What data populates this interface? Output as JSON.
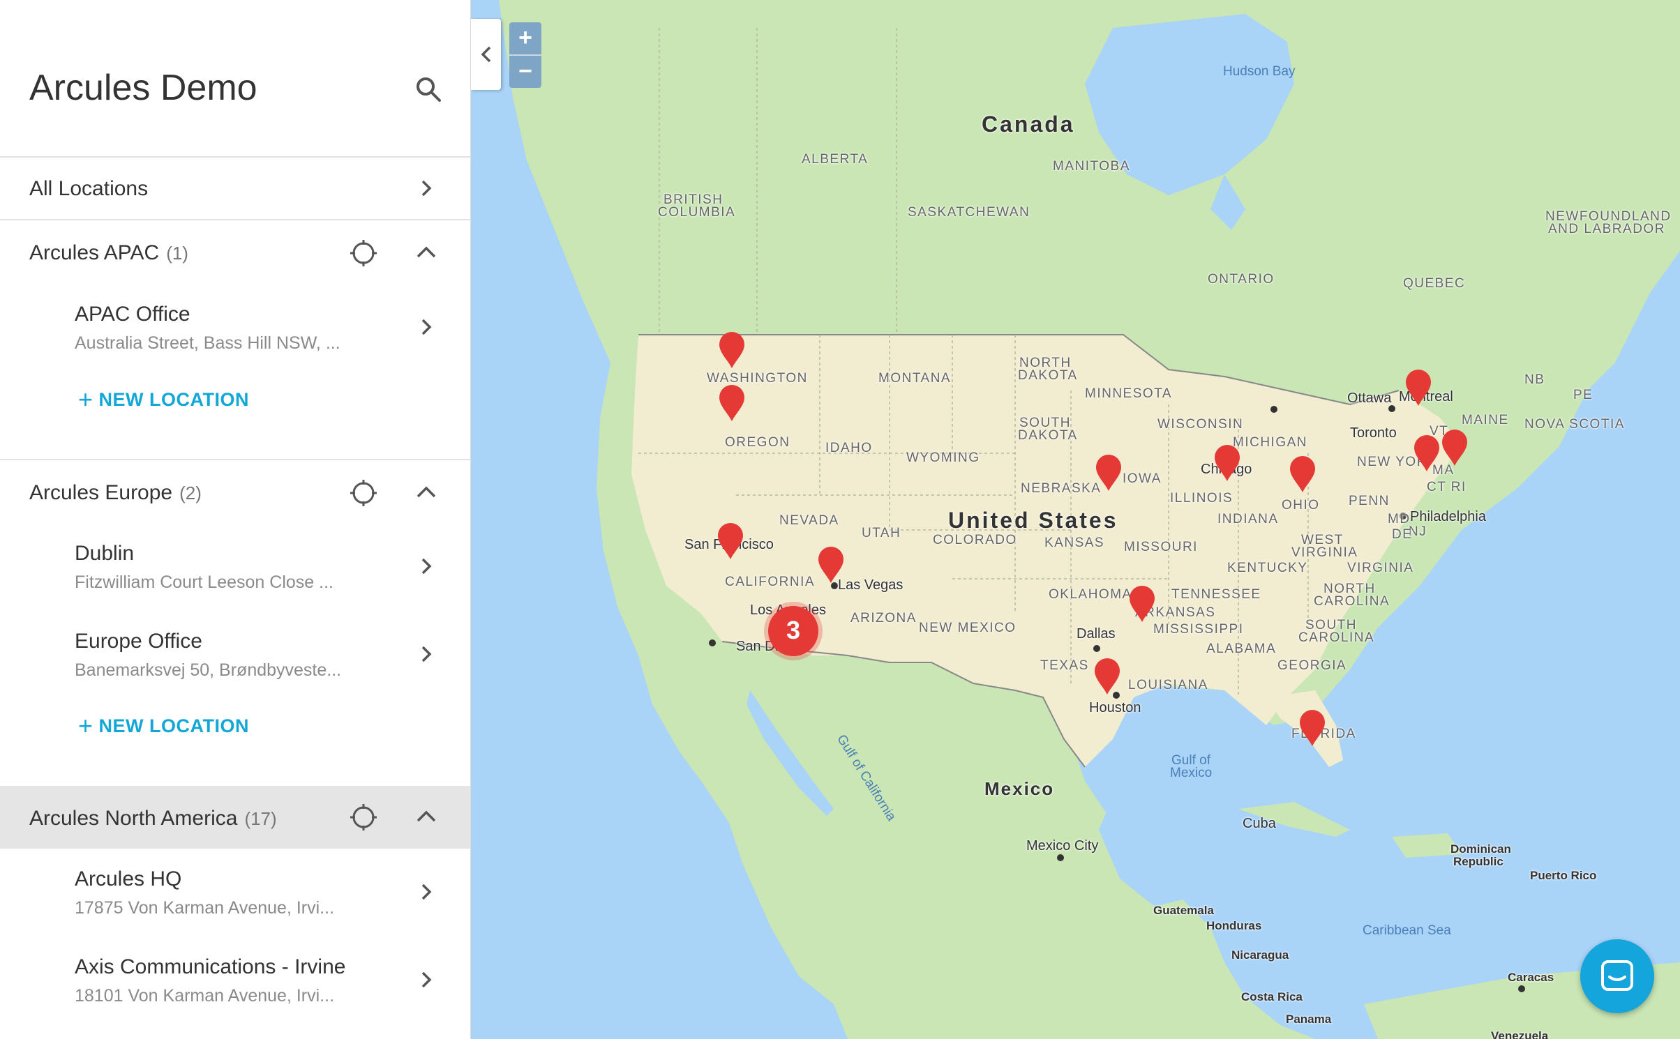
{
  "sidebar": {
    "title": "Arcules Demo",
    "all_locations": "All Locations",
    "groups": [
      {
        "name": "Arcules APAC",
        "count": "(1)",
        "locations": [
          {
            "title": "APAC Office",
            "address": "Australia Street, Bass Hill NSW, ..."
          }
        ],
        "new_location": "NEW LOCATION"
      },
      {
        "name": "Arcules Europe",
        "count": "(2)",
        "locations": [
          {
            "title": "Dublin",
            "address": "Fitzwilliam Court Leeson Close ..."
          },
          {
            "title": "Europe Office",
            "address": "Banemarksvej 50, Brøndbyveste..."
          }
        ],
        "new_location": "NEW LOCATION"
      },
      {
        "name": "Arcules North America",
        "count": "(17)",
        "locations": [
          {
            "title": "Arcules HQ",
            "address": "17875 Von Karman Avenue, Irvi..."
          },
          {
            "title": "Axis Communications - Irvine",
            "address": "18101 Von Karman Avenue, Irvi..."
          }
        ]
      }
    ]
  },
  "map": {
    "zoom_in": "+",
    "zoom_out": "−",
    "cluster_count": "3",
    "labels": {
      "canada": "Canada",
      "united_states": "United States",
      "mexico": "Mexico",
      "hudson_bay": "Hudson Bay",
      "alberta": "ALBERTA",
      "manitoba": "MANITOBA",
      "british_columbia_1": "BRITISH",
      "british_columbia_2": "COLUMBIA",
      "saskatchewan": "SASKATCHEWAN",
      "ontario": "ONTARIO",
      "quebec": "QUEBEC",
      "newfoundland_1": "NEWFOUNDLAND",
      "newfoundland_2": "AND LABRADOR",
      "washington": "WASHINGTON",
      "montana": "MONTANA",
      "north_dakota_1": "NORTH",
      "north_dakota_2": "DAKOTA",
      "minnesota": "MINNESOTA",
      "oregon": "OREGON",
      "idaho": "IDAHO",
      "wyoming": "WYOMING",
      "south_dakota_1": "SOUTH",
      "south_dakota_2": "DAKOTA",
      "wisconsin": "WISCONSIN",
      "michigan": "MICHIGAN",
      "ottawa": "Ottawa",
      "montreal": "Montreal",
      "toronto": "Toronto",
      "maine": "MAINE",
      "nb": "NB",
      "pe": "PE",
      "nova_scotia": "NOVA SCOTIA",
      "vt": "VT",
      "new_york": "NEW YOR",
      "ma": "MA",
      "ct_ri": "CT RI",
      "nebraska": "NEBRASKA",
      "iowa": "IOWA",
      "chicago": "Chicago",
      "illinois": "ILLINOIS",
      "ohio": "OHIO",
      "penn": "PENN",
      "nevada": "NEVADA",
      "utah": "UTAH",
      "colorado": "COLORADO",
      "kansas": "KANSAS",
      "missouri": "MISSOURI",
      "indiana": "INDIANA",
      "philadelphia": "Philadelphia",
      "nj": "NJ",
      "de": "DE",
      "md": "MD",
      "west_virginia_1": "WEST",
      "west_virginia_2": "VIRGINIA",
      "virginia": "VIRGINIA",
      "kentucky": "KENTUCKY",
      "san_francisco": "San Francisco",
      "las_vegas": "Las Vegas",
      "california": "CALIFORNIA",
      "oklahoma": "OKLAHOMA",
      "tennessee": "TENNESSEE",
      "north_carolina_1": "NORTH",
      "north_carolina_2": "CAROLINA",
      "los_angeles": "Los Angeles",
      "arizona": "ARIZONA",
      "new_mexico": "NEW MEXICO",
      "arkansas": "ARKANSAS",
      "mississippi": "MISSISSIPPI",
      "south_carolina_1": "SOUTH",
      "south_carolina_2": "CAROLINA",
      "san_diego": "San Diego",
      "dallas": "Dallas",
      "alabama": "ALABAMA",
      "georgia": "GEORGIA",
      "texas": "TEXAS",
      "louisiana": "LOUISIANA",
      "houston": "Houston",
      "florida": "FLORIDA",
      "gulf_of_california": "Gulf of California",
      "gulf_of_mexico_1": "Gulf of",
      "gulf_of_mexico_2": "Mexico",
      "cuba": "Cuba",
      "mexico_city": "Mexico City",
      "dominican_1": "Dominican",
      "dominican_2": "Republic",
      "puerto_rico": "Puerto Rico",
      "guatemala": "Guatemala",
      "honduras": "Honduras",
      "caribbean_sea": "Caribbean Sea",
      "nicaragua": "Nicaragua",
      "caracas": "Caracas",
      "costa_rica": "Costa Rica",
      "panama": "Panama",
      "venezuela": "Venezuela"
    },
    "colors": {
      "water": "#a9d3f7",
      "land": "#c9e6b4",
      "us_land": "#f2ecd0",
      "pin": "#e53935",
      "accent": "#12a7d6"
    }
  }
}
